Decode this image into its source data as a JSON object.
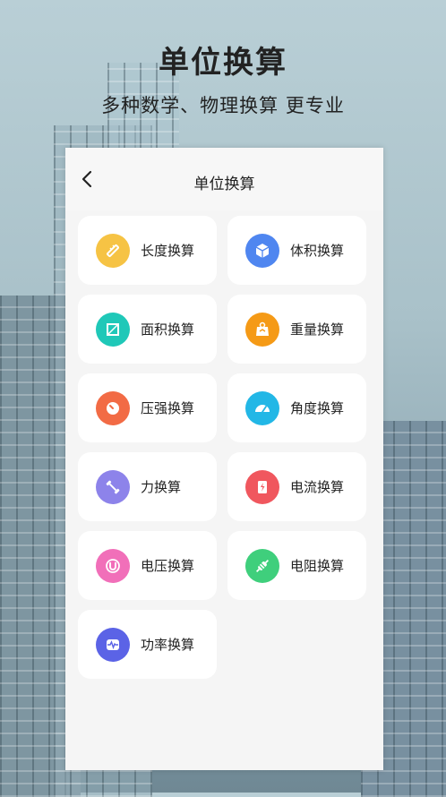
{
  "hero": {
    "title": "单位换算",
    "subtitle": "多种数学、物理换算 更专业"
  },
  "app": {
    "nav_title": "单位换算",
    "back_icon": "chevron-left-icon"
  },
  "items": [
    {
      "label": "长度换算",
      "icon": "ruler-icon",
      "color": "#f6c344"
    },
    {
      "label": "体积换算",
      "icon": "cube-icon",
      "color": "#4f86f0"
    },
    {
      "label": "面积换算",
      "icon": "area-icon",
      "color": "#1fc8b8"
    },
    {
      "label": "重量换算",
      "icon": "scale-icon",
      "color": "#f59a16"
    },
    {
      "label": "压强换算",
      "icon": "pressure-icon",
      "color": "#f26b45"
    },
    {
      "label": "角度换算",
      "icon": "gauge-icon",
      "color": "#22b7e6"
    },
    {
      "label": "力换算",
      "icon": "dumbbell-icon",
      "color": "#8d83ea"
    },
    {
      "label": "电流换算",
      "icon": "battery-bolt-icon",
      "color": "#f0575e"
    },
    {
      "label": "电压换算",
      "icon": "magnet-icon",
      "color": "#f16fb9"
    },
    {
      "label": "电阻换算",
      "icon": "resistor-icon",
      "color": "#3fcf7c"
    },
    {
      "label": "功率换算",
      "icon": "pulse-icon",
      "color": "#5b63e6"
    }
  ]
}
